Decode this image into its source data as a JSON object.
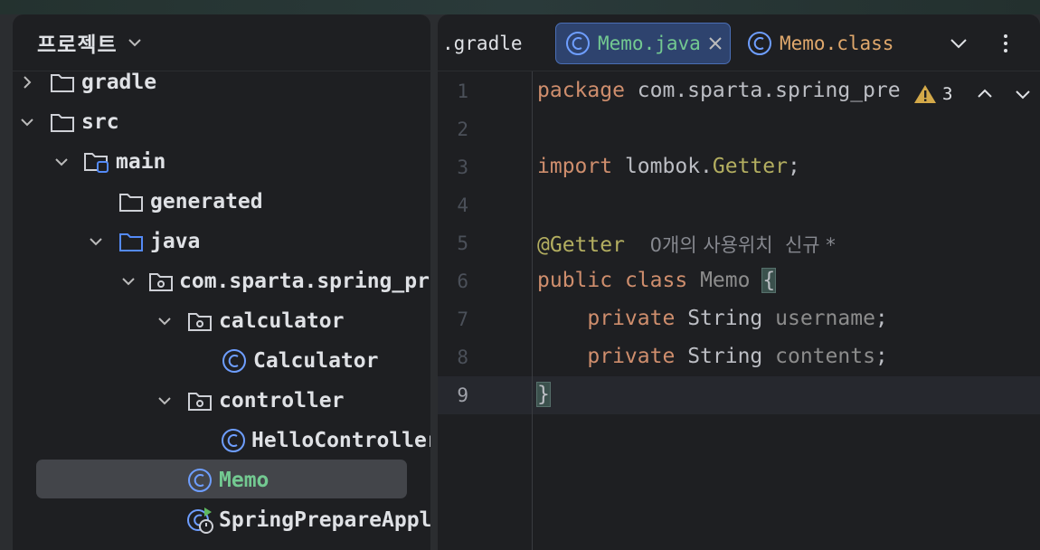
{
  "project_panel": {
    "title": "프로젝트",
    "tree": [
      {
        "label": "gradle",
        "icon": "folder-icon",
        "expanded": false
      },
      {
        "label": "src",
        "icon": "folder-icon",
        "expanded": true
      },
      {
        "label": "main",
        "icon": "source-folder-icon",
        "expanded": true
      },
      {
        "label": "generated",
        "icon": "folder-icon"
      },
      {
        "label": "java",
        "icon": "source-root-folder-icon",
        "expanded": true
      },
      {
        "label": "com.sparta.spring_pre",
        "icon": "package-icon",
        "expanded": true
      },
      {
        "label": "calculator",
        "icon": "package-icon",
        "expanded": true
      },
      {
        "label": "Calculator",
        "icon": "class-icon"
      },
      {
        "label": "controller",
        "icon": "package-icon",
        "expanded": true
      },
      {
        "label": "HelloController",
        "icon": "class-icon"
      },
      {
        "label": "Memo",
        "icon": "class-icon",
        "selected": true
      },
      {
        "label": "SpringPrepareAppli",
        "icon": "spring-boot-class-icon"
      }
    ]
  },
  "editor": {
    "tabs": [
      {
        "label": ".gradle"
      },
      {
        "label": "Memo.java",
        "active": true
      },
      {
        "label": "Memo.class"
      }
    ],
    "warning_count": "3",
    "lines": [
      {
        "n": "1",
        "pkg_kw": "package",
        "pkg_name": "com.sparta.spring_pre"
      },
      {
        "n": "2"
      },
      {
        "n": "3",
        "imp_kw": "import",
        "imp_path": "lombok.",
        "imp_cls": "Getter",
        "imp_semi": ";"
      },
      {
        "n": "4"
      },
      {
        "n": "5",
        "annotation": "@Getter",
        "hint": "0개의 사용위치  신규 *"
      },
      {
        "n": "6",
        "kw1": "public",
        "kw2": "class",
        "name": "Memo",
        "brace": "{"
      },
      {
        "n": "7",
        "kw": "private",
        "type": "String",
        "field": "username",
        "semi": ";"
      },
      {
        "n": "8",
        "kw": "private",
        "type": "String",
        "field": "contents",
        "semi": ";"
      },
      {
        "n": "9",
        "brace": "}"
      }
    ]
  },
  "colors": {
    "keyword": "#cf8e6d",
    "annotation": "#b3ae60",
    "class_icon": "#6e9eff",
    "selected_label": "#73c991"
  }
}
